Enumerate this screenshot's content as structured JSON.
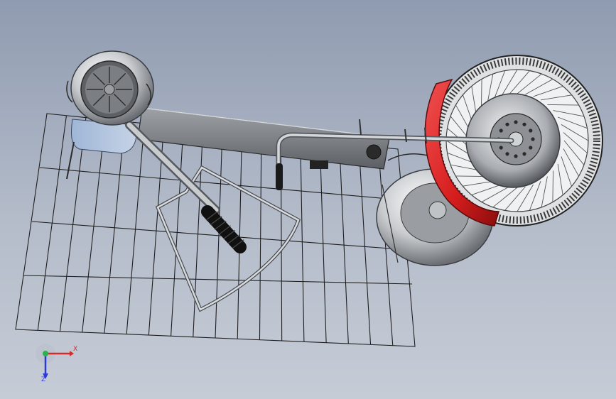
{
  "window": {
    "view": "CAD 3D viewport"
  },
  "model": {
    "name": "",
    "parts": [
      "frame-grid",
      "main-beam",
      "rear-wheel",
      "front-wheel",
      "red-fender",
      "front-fork",
      "handlebar",
      "seat-panel",
      "headlight",
      "rear-fender"
    ]
  },
  "triad": {
    "x_label": "X",
    "z_label": "Z",
    "x_color": "#d42a2a",
    "y_color": "#2bb34a",
    "z_color": "#2b3ad4"
  },
  "colors": {
    "background_top": "#8f9bb0",
    "background_bottom": "#c6ccd6",
    "metal": "#c9cccf",
    "fender": "#d61d1d",
    "rubber": "#1c1c1c",
    "grid": "#1f1f1f"
  }
}
